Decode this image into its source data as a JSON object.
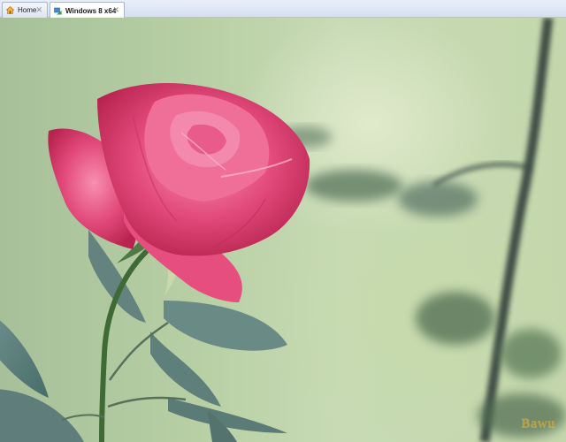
{
  "tabs": [
    {
      "label": "Home",
      "icon": "home-icon",
      "active": false
    },
    {
      "label": "Windows 8 x64",
      "icon": "vm-icon",
      "active": true
    }
  ],
  "desktop": {
    "wallpaper": "pink-rose-wallpaper",
    "watermark": "Bawu"
  },
  "colors": {
    "tab_active": "#ffffff",
    "rose_pink": "#e24a7c",
    "background_green": "#b8cfa4"
  }
}
